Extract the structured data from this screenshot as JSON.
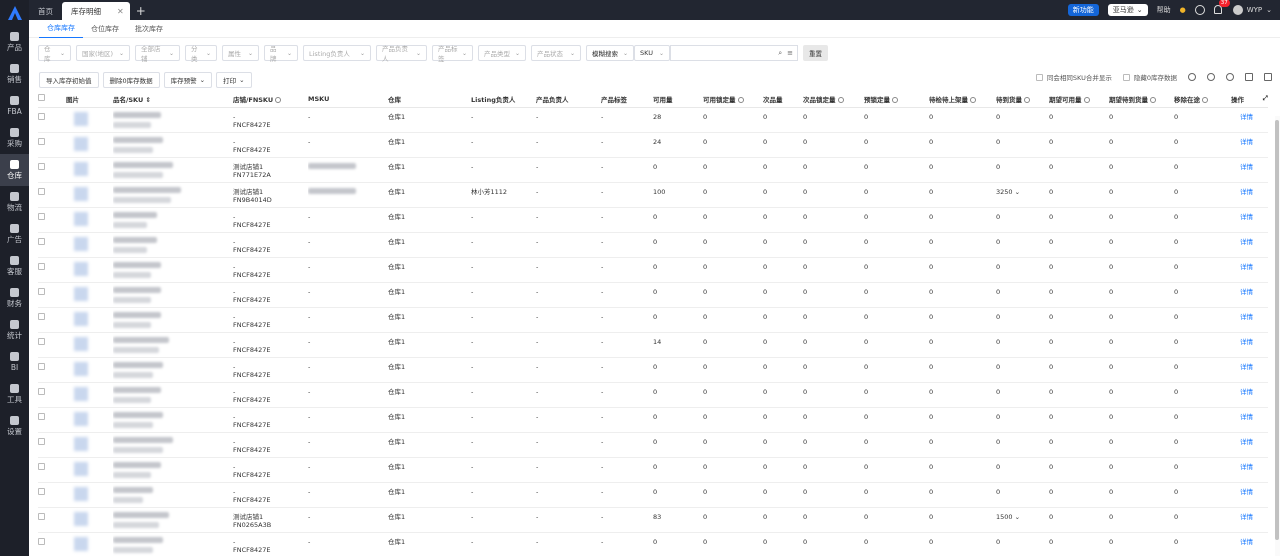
{
  "sidebar": {
    "items": [
      {
        "label": "产品",
        "icon": "box-icon"
      },
      {
        "label": "销售",
        "icon": "chart-icon"
      },
      {
        "label": "FBA",
        "icon": "fba-icon"
      },
      {
        "label": "采购",
        "icon": "cart-icon"
      },
      {
        "label": "仓库",
        "icon": "warehouse-icon"
      },
      {
        "label": "物流",
        "icon": "truck-icon"
      },
      {
        "label": "广告",
        "icon": "ad-icon"
      },
      {
        "label": "客服",
        "icon": "message-icon"
      },
      {
        "label": "财务",
        "icon": "finance-icon"
      },
      {
        "label": "统计",
        "icon": "stats-icon"
      },
      {
        "label": "BI",
        "icon": "bi-icon"
      },
      {
        "label": "工具",
        "icon": "tool-icon"
      },
      {
        "label": "设置",
        "icon": "gear-icon"
      }
    ]
  },
  "topbar": {
    "tabs": [
      {
        "label": "首页"
      },
      {
        "label": "库存明细"
      }
    ],
    "new_feature": "新功能",
    "marketplace": "亚马逊",
    "help": "帮助",
    "badge": "37",
    "user": "WYP"
  },
  "subtabs": [
    {
      "label": "仓库库存"
    },
    {
      "label": "仓位库存"
    },
    {
      "label": "批次库存"
    }
  ],
  "filters": {
    "items": [
      "仓库",
      "国家(地区)",
      "全部店铺",
      "分类",
      "属性",
      "品牌",
      "Listing负责人",
      "产品负责人",
      "产品标签",
      "产品类型",
      "产品状态"
    ],
    "search_type": "模糊搜索",
    "search_field": "SKU",
    "reset": "重置"
  },
  "actions": {
    "buttons": [
      "导入库存初始值",
      "删除0库存数据",
      "库存预警",
      "打印"
    ],
    "merge_label": "同会相同SKU合并显示",
    "hide_zero": "隐藏0库存数据"
  },
  "table": {
    "headers": [
      "图片",
      "品名/SKU",
      "店铺/FNSKU",
      "MSKU",
      "仓库",
      "Listing负责人",
      "产品负责人",
      "产品标签",
      "可用量",
      "可用锁定量",
      "次品量",
      "次品锁定量",
      "预锁定量",
      "待检待上架量",
      "待到货量",
      "期望可用量",
      "期望待到货量",
      "移除在途",
      "操作"
    ],
    "rows": [
      {
        "store": "-",
        "fnsku": "FNCF8427E",
        "msku": "-",
        "wh": "仓库1",
        "listing": "-",
        "owner": "-",
        "tag": "-",
        "avail": "28",
        "locked": "0",
        "def": "0",
        "deflock": "0",
        "pre": "0",
        "insp": "0",
        "inbound": "0",
        "exp": "0",
        "expin": "0",
        "remove": "0",
        "op": "详情"
      },
      {
        "store": "-",
        "fnsku": "FNCF8427E",
        "msku": "-",
        "wh": "仓库1",
        "listing": "-",
        "owner": "-",
        "tag": "-",
        "avail": "24",
        "locked": "0",
        "def": "0",
        "deflock": "0",
        "pre": "0",
        "insp": "0",
        "inbound": "0",
        "exp": "0",
        "expin": "0",
        "remove": "0",
        "op": "详情"
      },
      {
        "store": "测试店铺1",
        "fnsku": "FN771E72A",
        "msku": "",
        "wh": "仓库1",
        "listing": "-",
        "owner": "-",
        "tag": "-",
        "avail": "0",
        "locked": "0",
        "def": "0",
        "deflock": "0",
        "pre": "0",
        "insp": "0",
        "inbound": "0",
        "exp": "0",
        "expin": "0",
        "remove": "0",
        "op": "详情"
      },
      {
        "store": "测试店铺1",
        "fnsku": "FN9B4014D",
        "msku": "",
        "wh": "仓库1",
        "listing": "林小芳1112",
        "owner": "-",
        "tag": "-",
        "avail": "100",
        "locked": "0",
        "def": "0",
        "deflock": "0",
        "pre": "0",
        "insp": "0",
        "inbound": "3250 ⌄",
        "exp": "0",
        "expin": "0",
        "remove": "0",
        "op": "详情"
      },
      {
        "store": "-",
        "fnsku": "FNCF8427E",
        "msku": "-",
        "wh": "仓库1",
        "listing": "-",
        "owner": "-",
        "tag": "-",
        "avail": "0",
        "locked": "0",
        "def": "0",
        "deflock": "0",
        "pre": "0",
        "insp": "0",
        "inbound": "0",
        "exp": "0",
        "expin": "0",
        "remove": "0",
        "op": "详情"
      },
      {
        "store": "-",
        "fnsku": "FNCF8427E",
        "msku": "-",
        "wh": "仓库1",
        "listing": "-",
        "owner": "-",
        "tag": "-",
        "avail": "0",
        "locked": "0",
        "def": "0",
        "deflock": "0",
        "pre": "0",
        "insp": "0",
        "inbound": "0",
        "exp": "0",
        "expin": "0",
        "remove": "0",
        "op": "详情"
      },
      {
        "store": "-",
        "fnsku": "FNCF8427E",
        "msku": "-",
        "wh": "仓库1",
        "listing": "-",
        "owner": "-",
        "tag": "-",
        "avail": "0",
        "locked": "0",
        "def": "0",
        "deflock": "0",
        "pre": "0",
        "insp": "0",
        "inbound": "0",
        "exp": "0",
        "expin": "0",
        "remove": "0",
        "op": "详情"
      },
      {
        "store": "-",
        "fnsku": "FNCF8427E",
        "msku": "-",
        "wh": "仓库1",
        "listing": "-",
        "owner": "-",
        "tag": "-",
        "avail": "0",
        "locked": "0",
        "def": "0",
        "deflock": "0",
        "pre": "0",
        "insp": "0",
        "inbound": "0",
        "exp": "0",
        "expin": "0",
        "remove": "0",
        "op": "详情"
      },
      {
        "store": "-",
        "fnsku": "FNCF8427E",
        "msku": "-",
        "wh": "仓库1",
        "listing": "-",
        "owner": "-",
        "tag": "-",
        "avail": "0",
        "locked": "0",
        "def": "0",
        "deflock": "0",
        "pre": "0",
        "insp": "0",
        "inbound": "0",
        "exp": "0",
        "expin": "0",
        "remove": "0",
        "op": "详情"
      },
      {
        "store": "-",
        "fnsku": "FNCF8427E",
        "msku": "-",
        "wh": "仓库1",
        "listing": "-",
        "owner": "-",
        "tag": "-",
        "avail": "14",
        "locked": "0",
        "def": "0",
        "deflock": "0",
        "pre": "0",
        "insp": "0",
        "inbound": "0",
        "exp": "0",
        "expin": "0",
        "remove": "0",
        "op": "详情"
      },
      {
        "store": "-",
        "fnsku": "FNCF8427E",
        "msku": "-",
        "wh": "仓库1",
        "listing": "-",
        "owner": "-",
        "tag": "-",
        "avail": "0",
        "locked": "0",
        "def": "0",
        "deflock": "0",
        "pre": "0",
        "insp": "0",
        "inbound": "0",
        "exp": "0",
        "expin": "0",
        "remove": "0",
        "op": "详情"
      },
      {
        "store": "-",
        "fnsku": "FNCF8427E",
        "msku": "-",
        "wh": "仓库1",
        "listing": "-",
        "owner": "-",
        "tag": "-",
        "avail": "0",
        "locked": "0",
        "def": "0",
        "deflock": "0",
        "pre": "0",
        "insp": "0",
        "inbound": "0",
        "exp": "0",
        "expin": "0",
        "remove": "0",
        "op": "详情"
      },
      {
        "store": "-",
        "fnsku": "FNCF8427E",
        "msku": "-",
        "wh": "仓库1",
        "listing": "-",
        "owner": "-",
        "tag": "-",
        "avail": "0",
        "locked": "0",
        "def": "0",
        "deflock": "0",
        "pre": "0",
        "insp": "0",
        "inbound": "0",
        "exp": "0",
        "expin": "0",
        "remove": "0",
        "op": "详情"
      },
      {
        "store": "-",
        "fnsku": "FNCF8427E",
        "msku": "-",
        "wh": "仓库1",
        "listing": "-",
        "owner": "-",
        "tag": "-",
        "avail": "0",
        "locked": "0",
        "def": "0",
        "deflock": "0",
        "pre": "0",
        "insp": "0",
        "inbound": "0",
        "exp": "0",
        "expin": "0",
        "remove": "0",
        "op": "详情"
      },
      {
        "store": "-",
        "fnsku": "FNCF8427E",
        "msku": "-",
        "wh": "仓库1",
        "listing": "-",
        "owner": "-",
        "tag": "-",
        "avail": "0",
        "locked": "0",
        "def": "0",
        "deflock": "0",
        "pre": "0",
        "insp": "0",
        "inbound": "0",
        "exp": "0",
        "expin": "0",
        "remove": "0",
        "op": "详情"
      },
      {
        "store": "-",
        "fnsku": "FNCF8427E",
        "msku": "-",
        "wh": "仓库1",
        "listing": "-",
        "owner": "-",
        "tag": "-",
        "avail": "0",
        "locked": "0",
        "def": "0",
        "deflock": "0",
        "pre": "0",
        "insp": "0",
        "inbound": "0",
        "exp": "0",
        "expin": "0",
        "remove": "0",
        "op": "详情"
      },
      {
        "store": "测试店铺1",
        "fnsku": "FN0265A3B",
        "msku": "-",
        "wh": "仓库1",
        "listing": "-",
        "owner": "-",
        "tag": "-",
        "avail": "83",
        "locked": "0",
        "def": "0",
        "deflock": "0",
        "pre": "0",
        "insp": "0",
        "inbound": "1500 ⌄",
        "exp": "0",
        "expin": "0",
        "remove": "0",
        "op": "详情"
      },
      {
        "store": "-",
        "fnsku": "FNCF8427E",
        "msku": "-",
        "wh": "仓库1",
        "listing": "-",
        "owner": "-",
        "tag": "-",
        "avail": "0",
        "locked": "0",
        "def": "0",
        "deflock": "0",
        "pre": "0",
        "insp": "0",
        "inbound": "0",
        "exp": "0",
        "expin": "0",
        "remove": "0",
        "op": "详情"
      },
      {
        "store": "-",
        "fnsku": "FNCF8427E",
        "msku": "-",
        "wh": "仓库1",
        "listing": "-",
        "owner": "-",
        "tag": "-",
        "avail": "0",
        "locked": "0",
        "def": "0",
        "deflock": "0",
        "pre": "0",
        "insp": "0",
        "inbound": "0",
        "exp": "0",
        "expin": "0",
        "remove": "0",
        "op": "详情"
      }
    ]
  }
}
